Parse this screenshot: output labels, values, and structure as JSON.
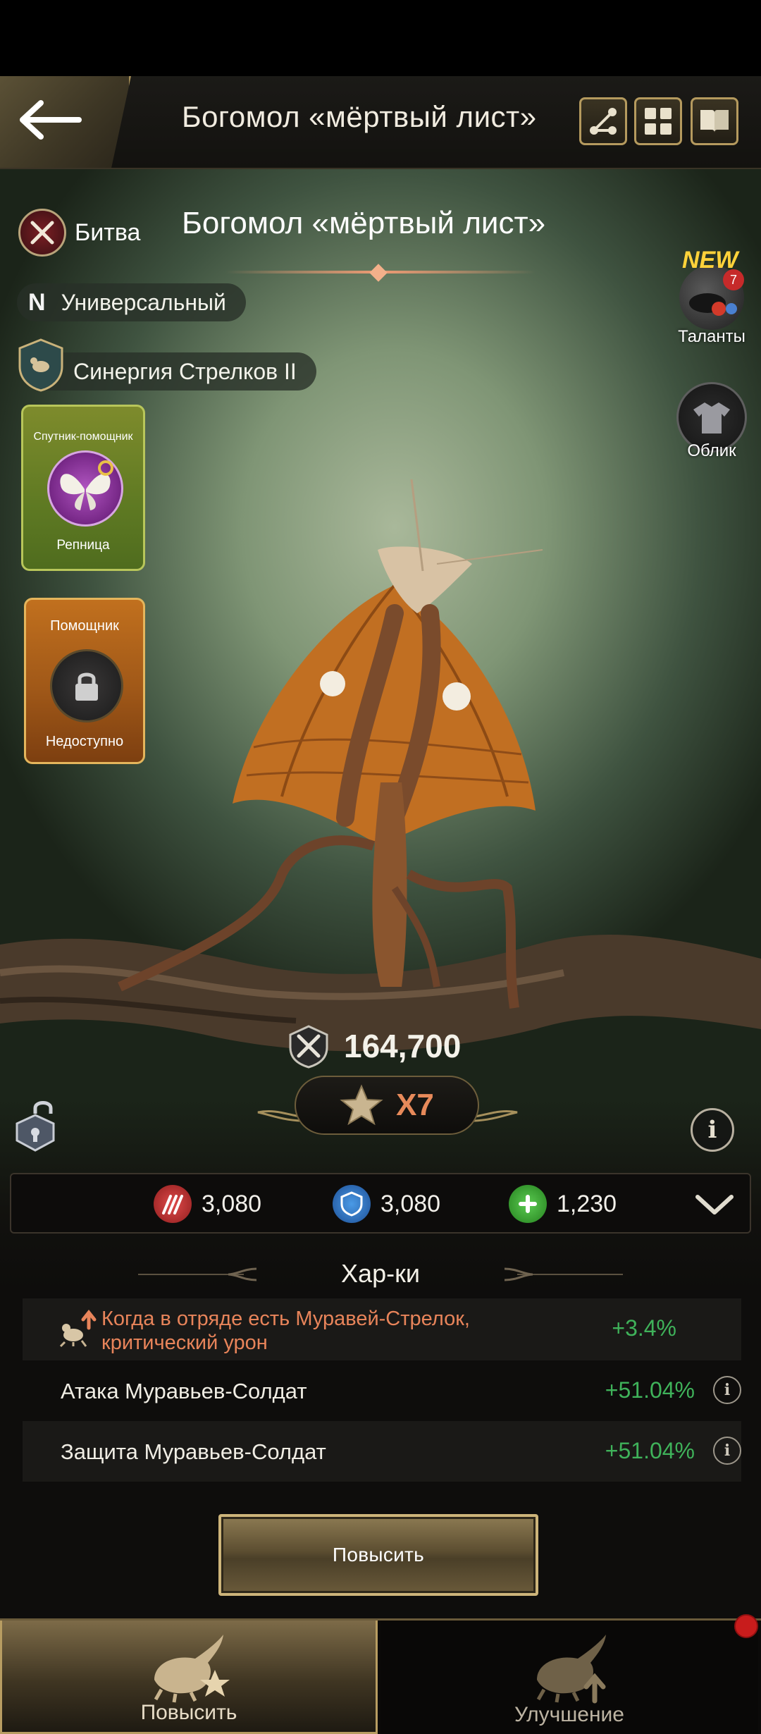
{
  "header": {
    "title": "Богомол «мёртвый лист»",
    "icons": [
      "share-graph-icon",
      "grid-icon",
      "book-icon"
    ]
  },
  "unit": {
    "name": "Богомол «мёртвый лист»",
    "role": "Битва",
    "type_letter": "N",
    "type": "Универсальный",
    "synergy": "Синергия Стрелков II"
  },
  "companions": {
    "helper_satellite_title": "Спутник-помощник",
    "helper_satellite_name": "Репница",
    "helper_title": "Помощник",
    "helper_status": "Недоступно"
  },
  "right_panel": {
    "new_badge": "NEW",
    "talents_count": "7",
    "talents_label": "Таланты",
    "skin_label": "Облик"
  },
  "power": {
    "value": "164,700",
    "star_level": "X7"
  },
  "stats": {
    "attack": "3,080",
    "defense": "3,080",
    "health": "1,230"
  },
  "characteristics": {
    "title": "Хар-ки",
    "rows": [
      {
        "label": "Когда в отряде есть Муравей-Стрелок, критический урон",
        "value": "+3.4%",
        "highlight": "#e8845a"
      },
      {
        "label": "Атака Муравьев-Солдат",
        "value": "+51.04%"
      },
      {
        "label": "Защита Муравьев-Солдат",
        "value": "+51.04%"
      }
    ]
  },
  "actions": {
    "promote_button": "Повысить"
  },
  "tabs": [
    {
      "label": "Повысить",
      "active": true
    },
    {
      "label": "Улучшение",
      "active": false
    }
  ],
  "colors": {
    "accent_gold": "#b89d62",
    "positive_green": "#3fb25a",
    "highlight_orange": "#e8845a",
    "star_level": "#e78a5a"
  }
}
